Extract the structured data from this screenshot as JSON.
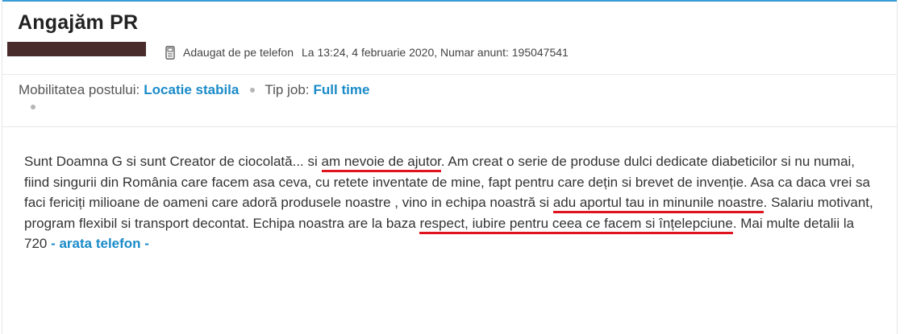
{
  "ad": {
    "title": "Angajăm PR",
    "meta": {
      "source_icon": "phone-icon",
      "source": "Adaugat de pe telefon",
      "posted": "La 13:24, 4 februarie 2020, Numar anunt: 195047541"
    },
    "details": [
      {
        "label": "Mobilitatea postului:",
        "value": "Locatie stabila"
      },
      {
        "label": "Tip job:",
        "value": "Full time"
      }
    ],
    "description": {
      "p1": "Sunt Doamna G si sunt Creator de ciocolată... si ",
      "h1": "am nevoie de ajutor",
      "p2": ". Am creat o serie de produse dulci dedicate diabeticilor si nu numai, fiind singurii din România care facem asa ceva, cu retete inventate de mine, fapt pentru care dețin si brevet de invenție. Asa ca daca vrei sa faci fericiți milioane de oameni care adoră produsele noastre , vino in echipa noastră si ",
      "h2": "adu aportul tau in minunile noastre",
      "p3": ". Salariu motivant, program flexibil si transport decontat. Echipa noastra are la baza ",
      "h3": "respect, iubire pentru ceea ce facem si înțelepciune",
      "p4": ". Mai multe detalii la 720 ",
      "show_phone": "- arata telefon -"
    }
  },
  "colors": {
    "accent": "#1a8bc8",
    "underline": "#e0141e",
    "redaction": "#4a2b2b"
  }
}
